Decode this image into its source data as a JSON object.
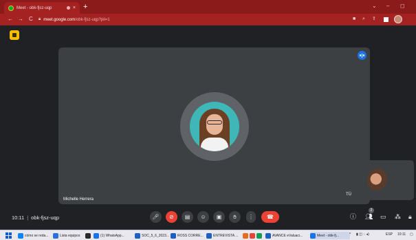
{
  "browser": {
    "tab_title": "Meet - obk-fjsz-uqp",
    "tab_close": "×",
    "new_tab": "+",
    "url_host": "meet.google.com",
    "url_path": "/obk-fjsz-uqp?pli=1"
  },
  "meet": {
    "main_participant_name": "Michelle Herrera",
    "self_label": "TÚ",
    "meeting_time": "10:11",
    "meeting_separator": "|",
    "meeting_code": "obk-fjsz-uqp",
    "participant_count": "2",
    "colors": {
      "end_call": "#ea4335",
      "speaking": "#1a73e8",
      "panel": "#3c4043"
    }
  },
  "taskbar": {
    "items": [
      {
        "label": "cómo se reda...",
        "color": "#0a84ff"
      },
      {
        "label": "Lista equipos",
        "color": "#2f6fdc"
      },
      {
        "label": "",
        "color": "#2b2b2b"
      },
      {
        "label": "(1) WhatsApp...",
        "color": "#1a73e8"
      },
      {
        "label": "SOC_5_6_2023...",
        "color": "#1e5fbf"
      },
      {
        "label": "ROSS CORRE...",
        "color": "#1e5fbf"
      },
      {
        "label": "ENTREVISTA ...",
        "color": "#1e5fbf"
      },
      {
        "label": "",
        "color": "#e86a1a"
      },
      {
        "label": "",
        "color": "#ea4335"
      },
      {
        "label": "",
        "color": "#0f9d58"
      },
      {
        "label": "AVANCE eValuaci...",
        "color": "#1e5fbf"
      },
      {
        "label": "Meet - obk-fj...",
        "color": "#1a73e8"
      }
    ],
    "lang": "ESP",
    "clock": "10:11"
  }
}
